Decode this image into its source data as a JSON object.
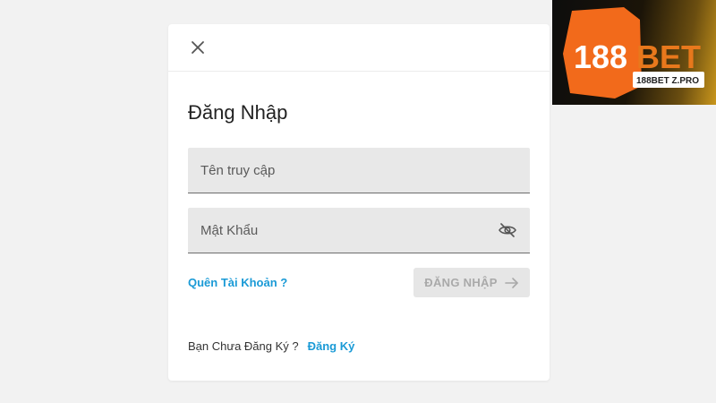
{
  "login_modal": {
    "title": "Đăng Nhập",
    "username_placeholder": "Tên truy cập",
    "password_placeholder": "Mật Khẩu",
    "forgot_label": "Quên Tài Khoản ?",
    "login_button_label": "ĐĂNG NHẬP",
    "signup_prompt": "Bạn Chưa Đăng Ký ?",
    "signup_link_label": "Đăng Ký"
  },
  "brand": {
    "logo_text": "188BET",
    "domain_text": "188BET Z.PRO"
  },
  "icons": {
    "close": "close-icon",
    "eye": "eye-off-icon",
    "arrow": "arrow-right-icon"
  },
  "colors": {
    "link": "#1a9ad6",
    "brand_orange": "#f26a1b",
    "button_disabled_bg": "#e6e6e6",
    "button_disabled_text": "#a9a9a9"
  }
}
